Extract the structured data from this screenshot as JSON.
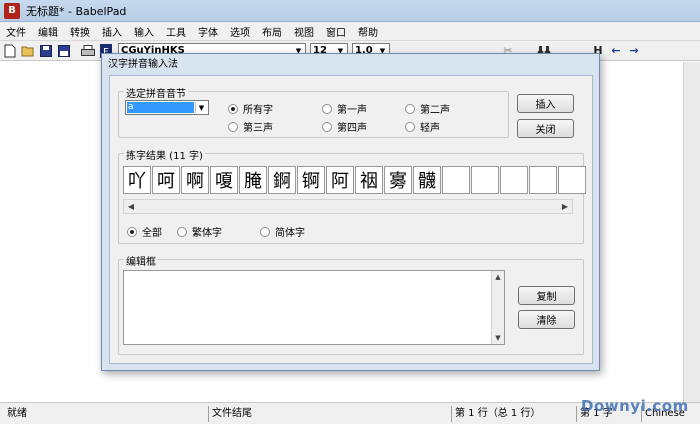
{
  "window": {
    "title": "无标题* - BabelPad",
    "app_icon": "B"
  },
  "menu": [
    "文件",
    "编辑",
    "转换",
    "插入",
    "输入",
    "工具",
    "字体",
    "选项",
    "布局",
    "视图",
    "窗口",
    "帮助"
  ],
  "toolbar": {
    "font_name": "CGuYinHKS",
    "font_size": "12",
    "line_spacing": "1.0",
    "icons": [
      "new-icon",
      "open-icon",
      "save-icon",
      "save-all-icon",
      "print-icon",
      "font-icon",
      "binoculars-icon",
      "heading-icon",
      "arrow-left-icon",
      "arrow-right-icon"
    ]
  },
  "dialog": {
    "title": "汉字拼音输入法",
    "syllable_group_label": "选定拼音音节",
    "syllable_value": "a",
    "tones": [
      {
        "label": "所有字",
        "checked": true
      },
      {
        "label": "第一声",
        "checked": false
      },
      {
        "label": "第二声",
        "checked": false
      },
      {
        "label": "第三声",
        "checked": false
      },
      {
        "label": "第四声",
        "checked": false
      },
      {
        "label": "轻声",
        "checked": false
      }
    ],
    "insert_button": "插入",
    "close_button": "关闭",
    "results_label": "拣字结果 (11 字)",
    "characters": [
      "吖",
      "呵",
      "啊",
      "嗄",
      "腌",
      "錒",
      "锕",
      "阿",
      "䄄",
      "㝰",
      "䯦",
      "",
      "",
      "",
      "",
      ""
    ],
    "script_filter": [
      {
        "label": "全部",
        "checked": true
      },
      {
        "label": "繁体字",
        "checked": false
      },
      {
        "label": "简体字",
        "checked": false
      }
    ],
    "edit_group_label": "编辑框",
    "copy_button": "复制",
    "clear_button": "清除"
  },
  "status": {
    "ready": "就绪",
    "file_end": "文件结尾",
    "line": "第 1 行（总 1 行）",
    "column": "第 1 字",
    "language": "Chinese"
  },
  "watermark": "Downyi.com"
}
